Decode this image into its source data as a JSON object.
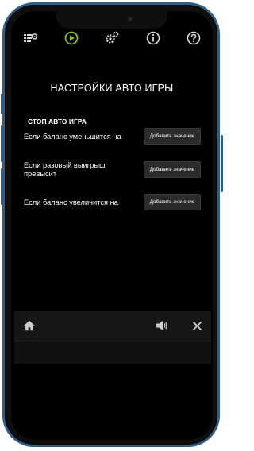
{
  "topbar": {
    "icons": [
      "settings-list-icon",
      "autoplay-icon",
      "gears-icon",
      "info-icon",
      "help-icon"
    ],
    "active_color": "#7dbe2a",
    "icon_color": "#d8d8d8"
  },
  "page": {
    "title": "НАСТРОЙКИ АВТО ИГРЫ",
    "section_title": "СТОП АВТО ИГРА"
  },
  "rows": [
    {
      "label": "Если баланс уменьшится на",
      "button": "Добавить значение"
    },
    {
      "label": "Если разовый выигрыш превысит",
      "button": "Добавить значение"
    },
    {
      "label": "Если баланс увеличится на",
      "button": "Добавить значение"
    }
  ],
  "bottom_bar": {
    "icons": [
      "home-icon",
      "sound-icon",
      "close-icon"
    ]
  },
  "colors": {
    "frame": "#2f5d86",
    "background": "#000000",
    "button_bg": "#2b2b2b"
  }
}
